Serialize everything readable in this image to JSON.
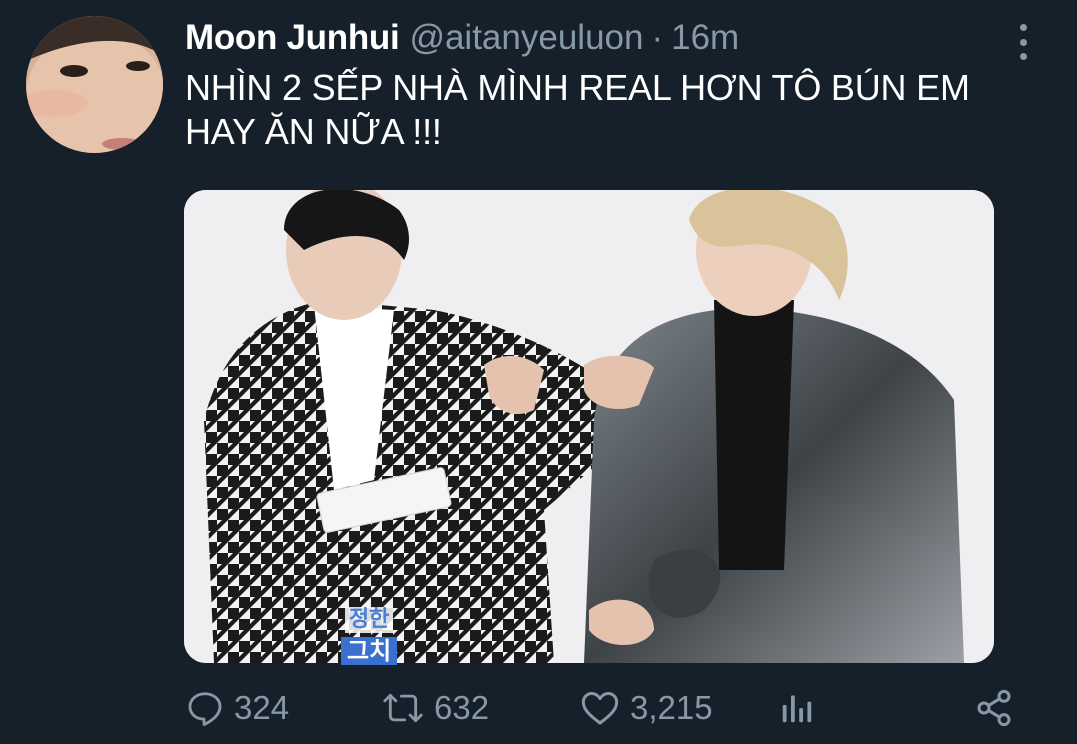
{
  "tweet": {
    "author": {
      "display_name": "Moon Junhui",
      "handle": "@aitanyeuluon",
      "separator": "·",
      "time": "16m",
      "avatar_icon": "profile-photo"
    },
    "text_line_1": "NHÌN 2 SẾP NHÀ MÌNH REAL HƠN TÔ BÚN EM",
    "text_line_2": "HAY ĂN NỮA !!!",
    "media": {
      "caption_name": "정한",
      "caption_word": "그치"
    },
    "actions": {
      "reply_count": "324",
      "retweet_count": "632",
      "like_count": "3,215"
    }
  },
  "colors": {
    "background": "#15202b",
    "text": "#ffffff",
    "secondary": "#8899a6"
  },
  "icons": [
    "more-vertical-icon",
    "reply-icon",
    "retweet-icon",
    "like-icon",
    "analytics-icon",
    "share-icon"
  ]
}
